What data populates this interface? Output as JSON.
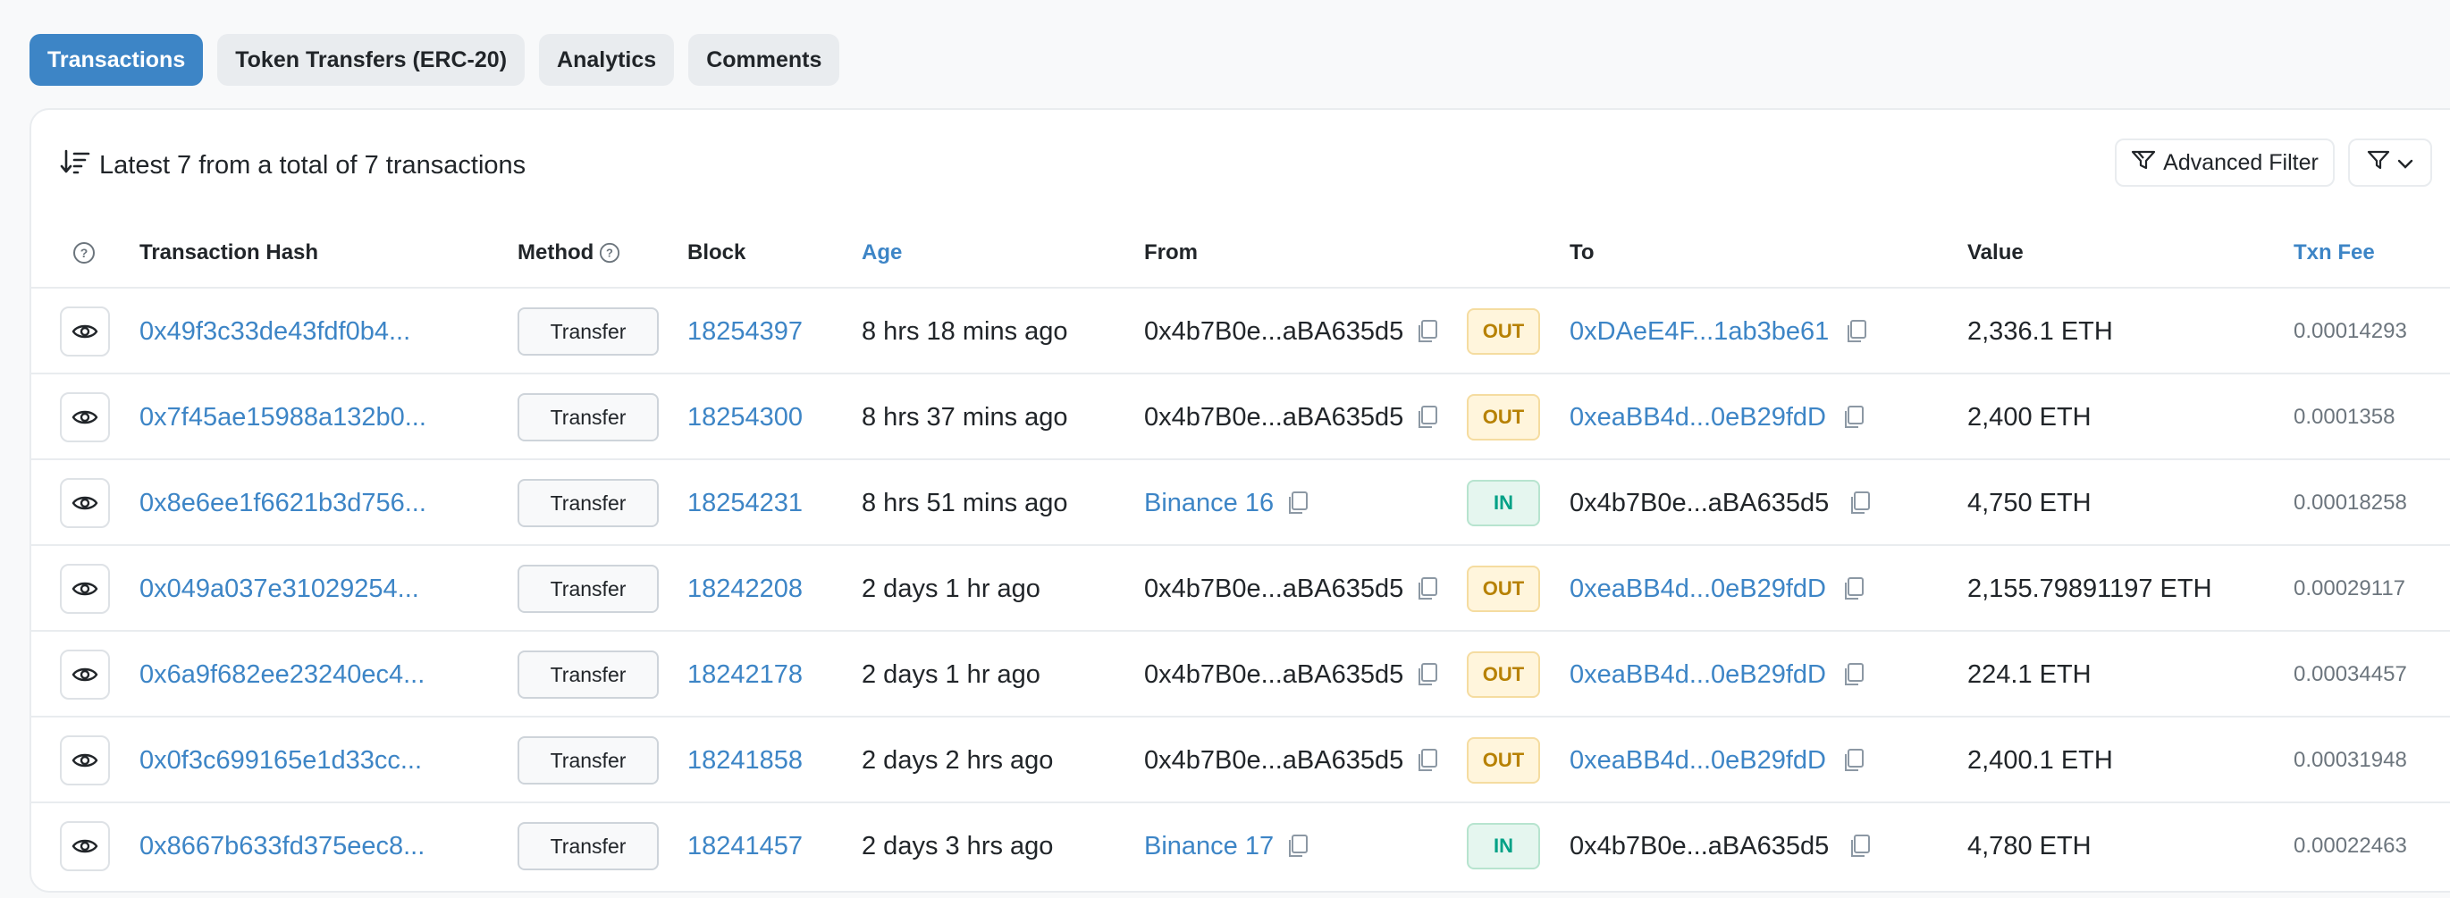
{
  "tabs": [
    "Transactions",
    "Token Transfers (ERC-20)",
    "Analytics",
    "Comments"
  ],
  "summary": "Latest 7 from a total of 7 transactions",
  "advanced_filter_label": "Advanced Filter",
  "columns": {
    "hash": "Transaction Hash",
    "method": "Method",
    "block": "Block",
    "age": "Age",
    "from": "From",
    "to": "To",
    "value": "Value",
    "fee": "Txn Fee"
  },
  "rows": [
    {
      "hash": "0x49f3c33de43fdf0b4...",
      "method": "Transfer",
      "block": "18254397",
      "age": "8 hrs 18 mins ago",
      "from": "0x4b7B0e...aBA635d5",
      "direction": "OUT",
      "to": "0xDAeE4F...1ab3be61",
      "value": "2,336.1 ETH",
      "fee": "0.00014293"
    },
    {
      "hash": "0x7f45ae15988a132b0...",
      "method": "Transfer",
      "block": "18254300",
      "age": "8 hrs 37 mins ago",
      "from": "0x4b7B0e...aBA635d5",
      "direction": "OUT",
      "to": "0xeaBB4d...0eB29fdD",
      "value": "2,400 ETH",
      "fee": "0.0001358"
    },
    {
      "hash": "0x8e6ee1f6621b3d756...",
      "method": "Transfer",
      "block": "18254231",
      "age": "8 hrs 51 mins ago",
      "from": "Binance 16",
      "direction": "IN",
      "to": "0x4b7B0e...aBA635d5",
      "value": "4,750 ETH",
      "fee": "0.00018258"
    },
    {
      "hash": "0x049a037e31029254...",
      "method": "Transfer",
      "block": "18242208",
      "age": "2 days 1 hr ago",
      "from": "0x4b7B0e...aBA635d5",
      "direction": "OUT",
      "to": "0xeaBB4d...0eB29fdD",
      "value": "2,155.79891197 ETH",
      "fee": "0.00029117"
    },
    {
      "hash": "0x6a9f682ee23240ec4...",
      "method": "Transfer",
      "block": "18242178",
      "age": "2 days 1 hr ago",
      "from": "0x4b7B0e...aBA635d5",
      "direction": "OUT",
      "to": "0xeaBB4d...0eB29fdD",
      "value": "224.1 ETH",
      "fee": "0.00034457"
    },
    {
      "hash": "0x0f3c699165e1d33cc...",
      "method": "Transfer",
      "block": "18241858",
      "age": "2 days 2 hrs ago",
      "from": "0x4b7B0e...aBA635d5",
      "direction": "OUT",
      "to": "0xeaBB4d...0eB29fdD",
      "value": "2,400.1 ETH",
      "fee": "0.00031948"
    },
    {
      "hash": "0x8667b633fd375eec8...",
      "method": "Transfer",
      "block": "18241457",
      "age": "2 days 3 hrs ago",
      "from": "Binance 17",
      "direction": "IN",
      "to": "0x4b7B0e...aBA635d5",
      "value": "4,780 ETH",
      "fee": "0.00022463"
    }
  ],
  "colors": {
    "accent": "#3d85c6",
    "out_badge": "#b78103",
    "in_badge": "#00a186"
  },
  "icons": {
    "sort": "sort-icon",
    "filter": "filter-icon",
    "eye": "eye-icon",
    "copy": "copy-icon",
    "help": "question-icon"
  }
}
